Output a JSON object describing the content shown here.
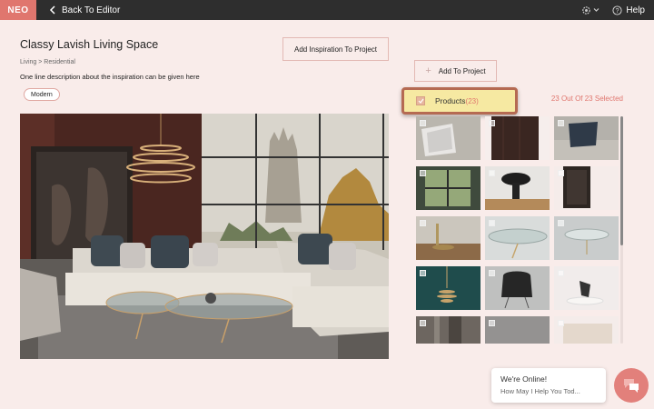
{
  "app": {
    "logo": "NEO",
    "back_label": "Back To Editor",
    "help_label": "Help"
  },
  "inspiration": {
    "title": "Classy Lavish Living Space",
    "breadcrumb": "Living > Residential",
    "description": "One line description about the inspiration can be given here",
    "tag": "Modern",
    "add_to_project_label": "Add Inspiration To Project"
  },
  "products": {
    "add_to_project_label": "Add To Project",
    "category_label": "Products",
    "category_count": "(23)",
    "selected_text": "23 Out Of 23 Selected",
    "items": [
      {
        "name": "throw-pillow-grey"
      },
      {
        "name": "wood-panel-dark"
      },
      {
        "name": "sofa-pillow-navy"
      },
      {
        "name": "window-frame-green"
      },
      {
        "name": "table-lamp-black"
      },
      {
        "name": "wall-art-dark"
      },
      {
        "name": "side-table-wood"
      },
      {
        "name": "glass-coffee-table"
      },
      {
        "name": "glass-side-table"
      },
      {
        "name": "pendant-light-gold"
      },
      {
        "name": "lounge-chair-black"
      },
      {
        "name": "sculpture-white"
      },
      {
        "name": "curtain-fabric"
      },
      {
        "name": "rug-grey"
      },
      {
        "name": "wall-beige"
      }
    ]
  },
  "chat": {
    "status": "We're Online!",
    "prompt": "How May I Help You Tod..."
  },
  "colors": {
    "accent": "#e0766e",
    "topbar": "#2e2e2e",
    "background": "#f9ecea",
    "highlight": "#f6e9a2"
  }
}
